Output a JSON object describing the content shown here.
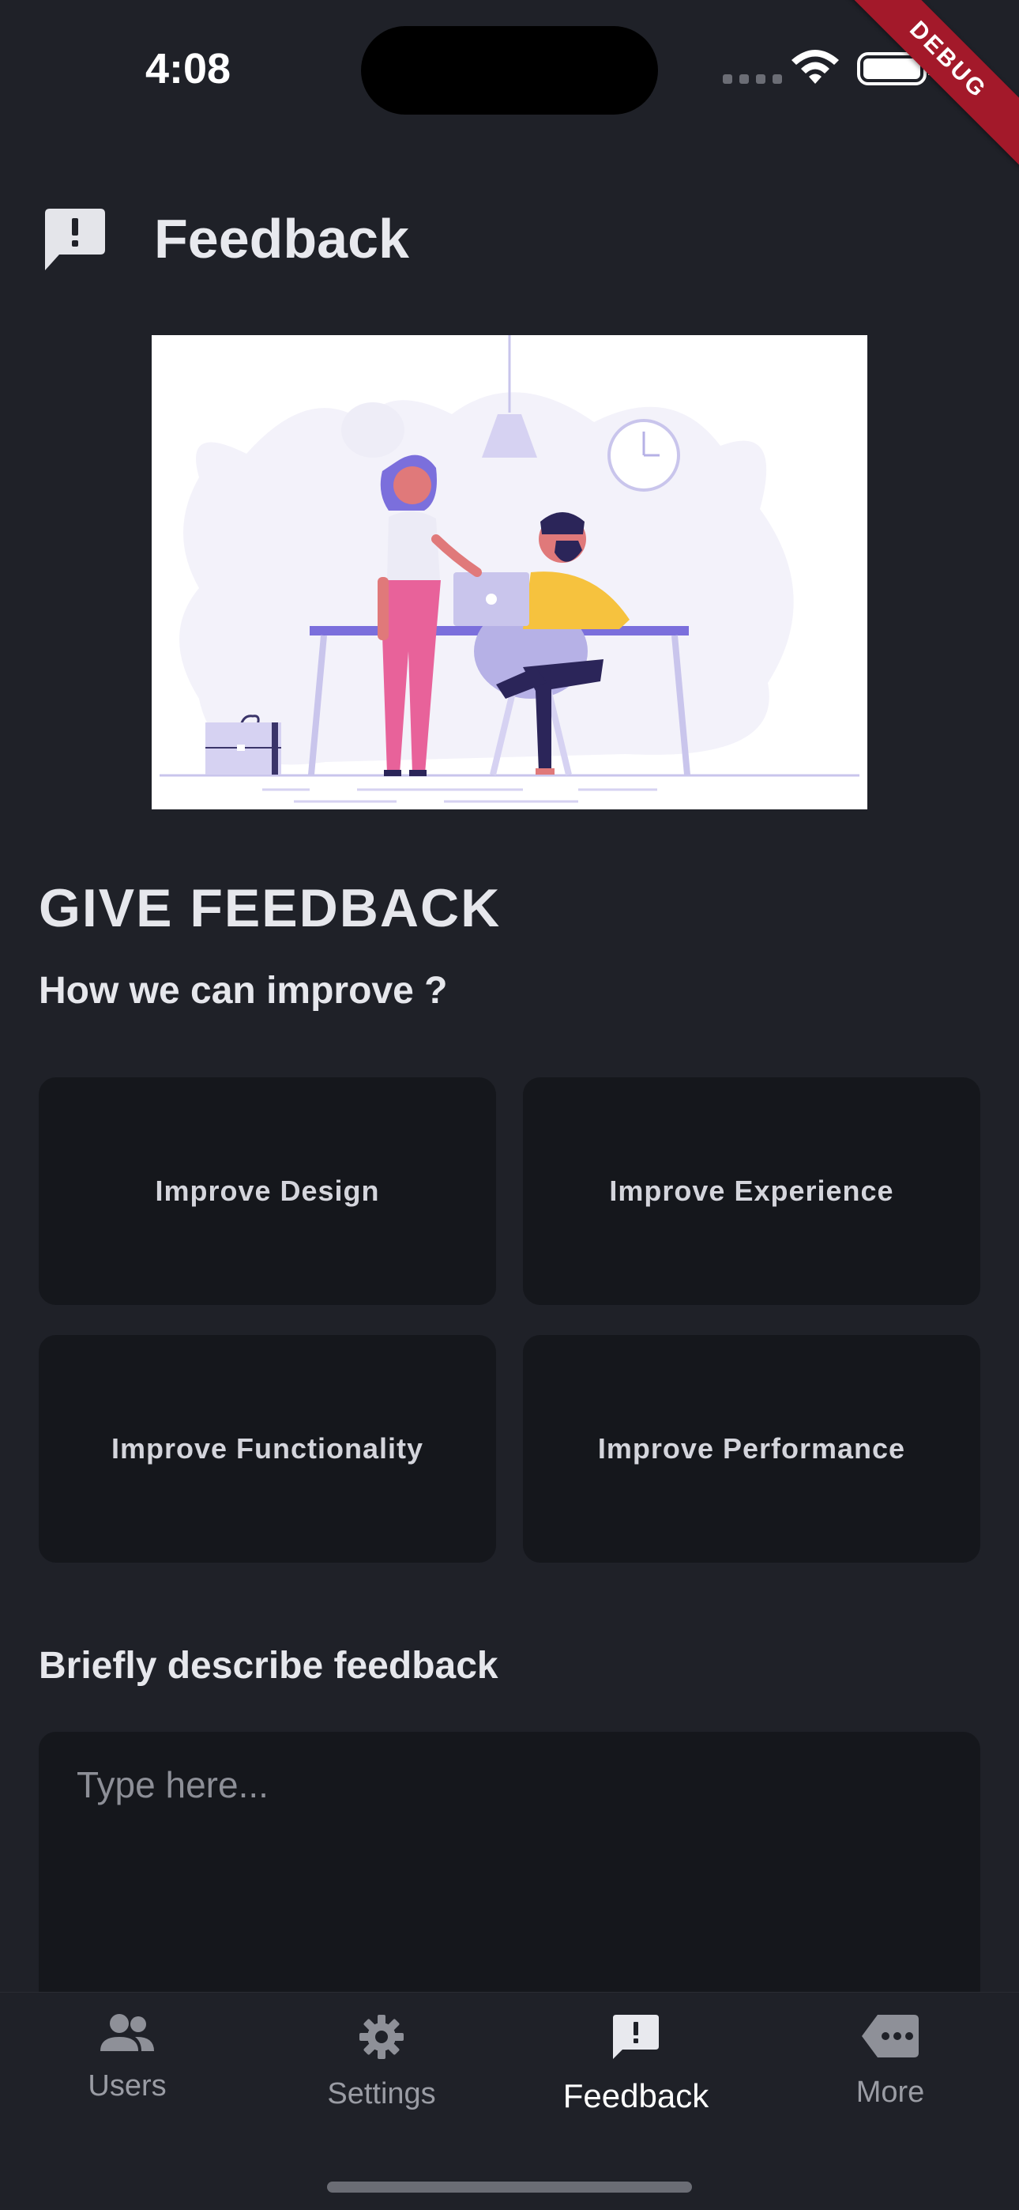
{
  "status": {
    "time": "4:08",
    "debug_label": "DEBUG"
  },
  "header": {
    "title": "Feedback",
    "icon": "feedback-icon"
  },
  "content": {
    "title": "GIVE FEEDBACK",
    "subtitle": "How we can improve ?",
    "options": [
      "Improve Design",
      "Improve Experience",
      "Improve Functionality",
      "Improve Performance"
    ],
    "describe_label": "Briefly describe feedback",
    "input_placeholder": "Type here..."
  },
  "nav": {
    "items": [
      {
        "label": "Users",
        "icon": "users-icon",
        "active": false
      },
      {
        "label": "Settings",
        "icon": "gear-icon",
        "active": false
      },
      {
        "label": "Feedback",
        "icon": "feedback-icon",
        "active": true
      },
      {
        "label": "More",
        "icon": "more-icon",
        "active": false
      }
    ]
  },
  "colors": {
    "background": "#1f2128",
    "card": "#15171c",
    "accent": "#7b6fdc",
    "debug": "#a3192a"
  }
}
